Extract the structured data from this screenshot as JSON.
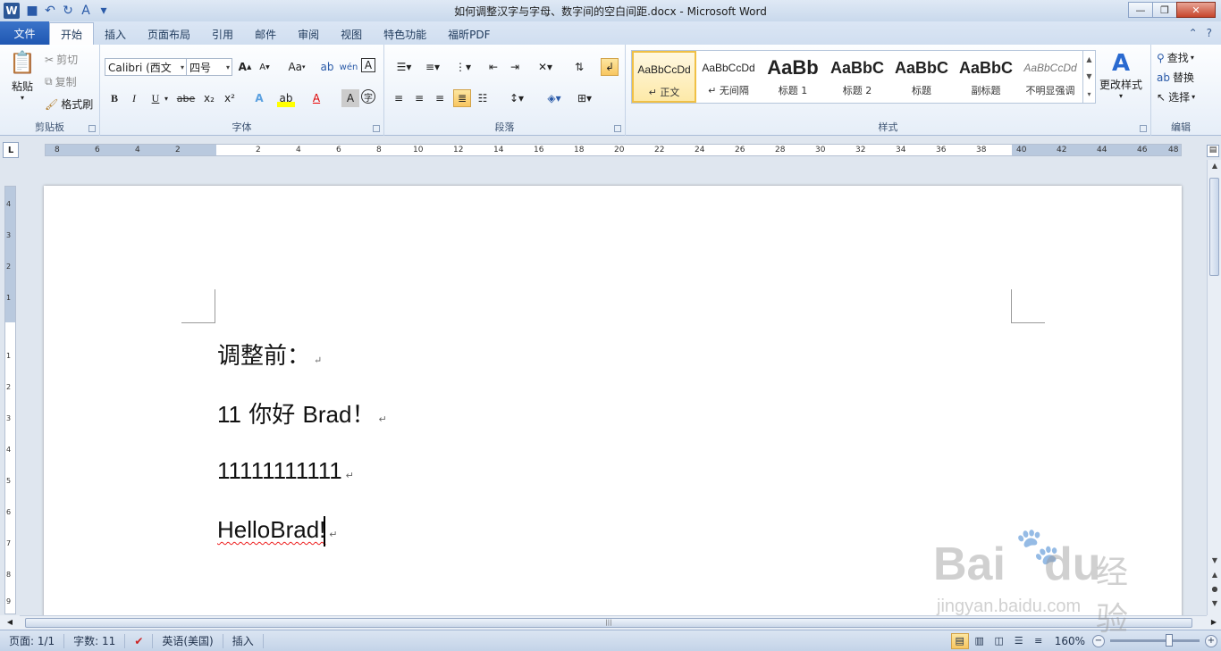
{
  "window": {
    "title": "如何调整汉字与字母、数字间的空白间距.docx  -  Microsoft Word",
    "logo_letter": "W"
  },
  "tabs": [
    "文件",
    "开始",
    "插入",
    "页面布局",
    "引用",
    "邮件",
    "审阅",
    "视图",
    "特色功能",
    "福昕PDF"
  ],
  "clipboard": {
    "paste": "粘贴",
    "cut": "剪切",
    "copy": "复制",
    "format_painter": "格式刷",
    "label": "剪贴板"
  },
  "font": {
    "name": "Calibri (西文",
    "size": "四号",
    "bold": "B",
    "italic": "I",
    "underline": "U",
    "strike": "abe",
    "subscript": "x₂",
    "superscript": "x²",
    "grow": "A",
    "shrink": "A",
    "change_case": "Aa",
    "font_color": "A",
    "label": "字体"
  },
  "paragraph": {
    "label": "段落"
  },
  "styles": {
    "items": [
      {
        "sample": "AaBbCcDd",
        "name": "↵ 正文"
      },
      {
        "sample": "AaBbCcDd",
        "name": "↵ 无间隔"
      },
      {
        "sample": "AaBb",
        "name": "标题 1"
      },
      {
        "sample": "AaBbC",
        "name": "标题 2"
      },
      {
        "sample": "AaBbC",
        "name": "标题"
      },
      {
        "sample": "AaBbC",
        "name": "副标题"
      },
      {
        "sample": "AaBbCcDd",
        "name": "不明显强调"
      }
    ],
    "change_styles": "更改样式",
    "label": "样式"
  },
  "editing": {
    "find": "查找",
    "replace": "替换",
    "select": "选择",
    "label": "编辑"
  },
  "ruler": {
    "corner": "L",
    "h_numbers": [
      "8",
      "6",
      "4",
      "2",
      "2",
      "4",
      "6",
      "8",
      "10",
      "12",
      "14",
      "16",
      "18",
      "20",
      "22",
      "24",
      "26",
      "28",
      "30",
      "32",
      "34",
      "36",
      "38",
      "40",
      "42",
      "44",
      "46",
      "48"
    ],
    "v_numbers": [
      "4",
      "3",
      "2",
      "1",
      "1",
      "2",
      "3",
      "4",
      "5",
      "6",
      "7",
      "8",
      "9"
    ]
  },
  "document": {
    "line1": "调整前：",
    "line2_num": "11",
    "line2_cn": "你好",
    "line2_en": "Brad",
    "line2_bang": "！",
    "line3": "11111111111",
    "line4": "HelloBrad!",
    "para_mark": "↵"
  },
  "status": {
    "page": "页面: 1/1",
    "words": "字数: 11",
    "language": "英语(美国)",
    "mode": "插入",
    "zoom": "160%",
    "zoom_level": 0.66
  },
  "watermark": {
    "brand": "Bai",
    "brand2": "du",
    "cn": "经验",
    "url": "jingyan.baidu.com"
  }
}
